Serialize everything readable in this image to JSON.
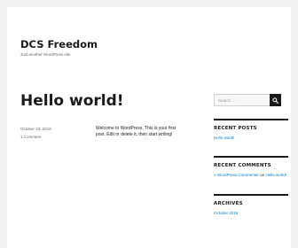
{
  "site": {
    "title": "DCS Freedom",
    "description": "Just another WordPress site"
  },
  "post": {
    "title": "Hello world!",
    "date": "October 23, 2016",
    "comments": "1 Comment",
    "content": "Welcome to WordPress. This is your first post. Edit or delete it, then start writing!"
  },
  "sidebar": {
    "search": {
      "placeholder": "Search …",
      "button_icon": "search-icon"
    },
    "recent_posts": {
      "title": "RECENT POSTS",
      "items": [
        "Hello world!"
      ]
    },
    "recent_comments": {
      "title": "RECENT COMMENTS",
      "author": "A WordPress Commenter",
      "on_word": "on",
      "post": "Hello world!"
    },
    "archives": {
      "title": "ARCHIVES",
      "items": [
        "October 2016"
      ]
    }
  },
  "colors": {
    "background": "#f1f1f1",
    "page": "#ffffff",
    "text": "#1a1a1a",
    "meta": "#686868",
    "link": "#007acc"
  }
}
